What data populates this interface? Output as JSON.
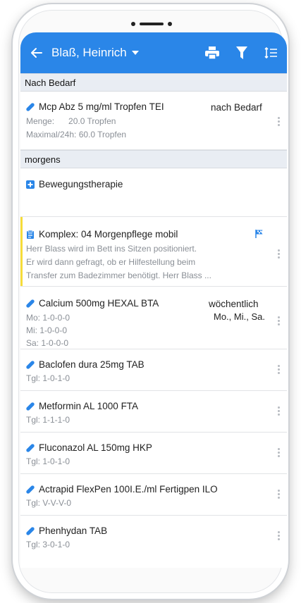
{
  "header": {
    "patient_name": "Blaß, Heinrich"
  },
  "sections": [
    {
      "label": "Nach Bedarf"
    },
    {
      "label": "morgens"
    }
  ],
  "items": [
    {
      "name": "Mcp Abz 5 mg/ml Tropfen TEI",
      "right": "nach Bedarf",
      "lines": [
        "Menge:      20.0 Tropfen",
        "Maximal/24h: 60.0 Tropfen"
      ]
    },
    {
      "name": "Bewegungstherapie"
    },
    {
      "name": "Komplex: 04 Morgenpflege mobil",
      "lines": [
        "Herr Blass wird im Bett ins Sitzen positioniert.",
        "Er wird dann gefragt, ob er Hilfestellung beim",
        "Transfer zum Badezimmer benötigt. Herr Blass ..."
      ]
    },
    {
      "name": "Calcium 500mg HEXAL BTA",
      "right": "wöchentlich",
      "right2": "Mo., Mi., Sa.",
      "lines": [
        "Mo: 1-0-0-0",
        "Mi: 1-0-0-0",
        "Sa: 1-0-0-0"
      ]
    },
    {
      "name": "Baclofen dura 25mg TAB",
      "lines": [
        "Tgl: 1-0-1-0"
      ]
    },
    {
      "name": "Metformin AL 1000 FTA",
      "lines": [
        "Tgl: 1-1-1-0"
      ]
    },
    {
      "name": "Fluconazol AL 150mg HKP",
      "lines": [
        "Tgl: 1-0-1-0"
      ]
    },
    {
      "name": "Actrapid FlexPen 100I.E./ml Fertigpen ILO",
      "lines": [
        "Tgl: V-V-V-0"
      ]
    },
    {
      "name": "Phenhydan TAB",
      "lines": [
        "Tgl: 3-0-1-0"
      ]
    }
  ],
  "colors": {
    "appbar": "#2a86e8",
    "accent_icon": "#2a86e8",
    "highlight_bar": "#f6dc3a"
  }
}
